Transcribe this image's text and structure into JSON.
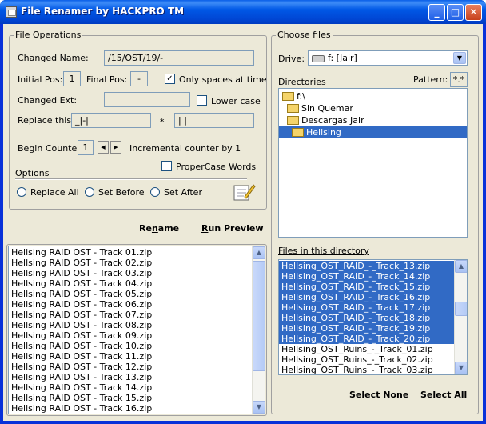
{
  "window": {
    "title": "File Renamer by HACKPRO TM"
  },
  "file_operations": {
    "group_title": "File Operations",
    "changed_name_label": "Changed Name:",
    "changed_name_value": "/15/OST/19/-",
    "initial_pos_label": "Initial Pos:",
    "initial_pos_value": "1",
    "final_pos_label": "Final Pos:",
    "final_pos_value": "-",
    "only_spaces_label": "Only spaces at time",
    "only_spaces_checked": true,
    "changed_ext_label": "Changed Ext:",
    "changed_ext_value": "",
    "lower_case_label": "Lower case",
    "lower_case_checked": false,
    "replace_this_label": "Replace this:",
    "replace_this_value": "_|-|",
    "replace_with_symbol": "*",
    "replace_with_value": "| |",
    "begin_counter_label": "Begin Counter:",
    "begin_counter_value": "1",
    "incremental_label": "Incremental counter by 1",
    "propercase_label": "ProperCase Words",
    "propercase_checked": false,
    "options_label": "Options",
    "radio_options": [
      "Replace All",
      "Set Before",
      "Set After"
    ]
  },
  "actions": {
    "rename": "Rename",
    "rename_accel": "n",
    "run_preview": "Run Preview",
    "run_preview_accel": "R"
  },
  "preview_list": [
    "Hellsing  RAID OST - Track 01.zip",
    "Hellsing  RAID OST - Track 02.zip",
    "Hellsing  RAID OST - Track 03.zip",
    "Hellsing  RAID OST - Track 04.zip",
    "Hellsing  RAID OST - Track 05.zip",
    "Hellsing  RAID OST - Track 06.zip",
    "Hellsing  RAID OST - Track 07.zip",
    "Hellsing  RAID OST - Track 08.zip",
    "Hellsing  RAID OST - Track 09.zip",
    "Hellsing  RAID OST - Track 10.zip",
    "Hellsing  RAID OST - Track 11.zip",
    "Hellsing  RAID OST - Track 12.zip",
    "Hellsing  RAID OST - Track 13.zip",
    "Hellsing  RAID OST - Track 14.zip",
    "Hellsing  RAID OST - Track 15.zip",
    "Hellsing  RAID OST - Track 16.zip"
  ],
  "choose_files": {
    "group_title": "Choose files",
    "drive_label": "Drive:",
    "drive_value": "f: [Jair]",
    "directories_label": "Directories",
    "pattern_label": "Pattern:",
    "pattern_value": "*.*",
    "directories": [
      {
        "name": "f:\\",
        "selected": false
      },
      {
        "name": "Sin Quemar",
        "selected": false
      },
      {
        "name": "Descargas Jair",
        "selected": false
      },
      {
        "name": "Hellsing",
        "selected": true
      }
    ],
    "files_label": "Files in this directory",
    "files": [
      {
        "name": "Hellsing_OST_RAID_-_Track_13.zip",
        "selected": true
      },
      {
        "name": "Hellsing_OST_RAID_-_Track_14.zip",
        "selected": true
      },
      {
        "name": "Hellsing_OST_RAID_-_Track_15.zip",
        "selected": true
      },
      {
        "name": "Hellsing_OST_RAID_-_Track_16.zip",
        "selected": true
      },
      {
        "name": "Hellsing_OST_RAID_-_Track_17.zip",
        "selected": true
      },
      {
        "name": "Hellsing_OST_RAID_-_Track_18.zip",
        "selected": true
      },
      {
        "name": "Hellsing_OST_RAID_-_Track_19.zip",
        "selected": true
      },
      {
        "name": "Hellsing_OST_RAID_-_Track_20.zip",
        "selected": true
      },
      {
        "name": "Hellsing_OST_Ruins_-_Track_01.zip",
        "selected": false
      },
      {
        "name": "Hellsing_OST_Ruins_-_Track_02.zip",
        "selected": false
      },
      {
        "name": "Hellsing_OST_Ruins_-_Track_03.zip",
        "selected": false
      }
    ],
    "select_none": "Select None",
    "select_all": "Select All"
  }
}
